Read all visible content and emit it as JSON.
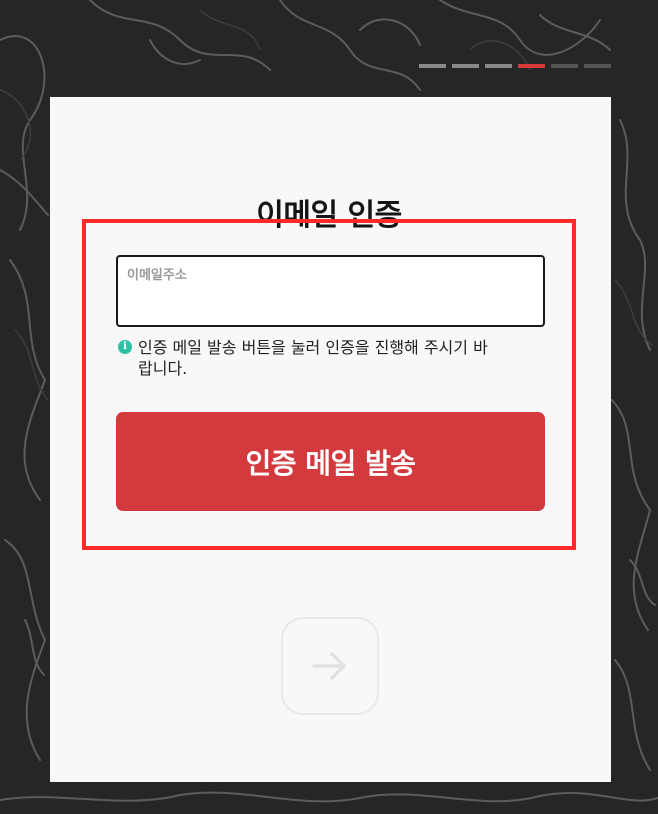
{
  "progress": {
    "total_steps": 6,
    "current_step": 4,
    "colors": {
      "done": "#8a8a8a",
      "current": "#d9383b",
      "upcoming": "#555555"
    }
  },
  "form": {
    "title": "이메일 인증",
    "email_field": {
      "label": "이메일주소",
      "value": "",
      "placeholder": ""
    },
    "help_icon": "info-icon",
    "help_text": "인증 메일 발송 버튼을 눌러 인증을 진행해 주시기 바랍니다.",
    "send_button_label": "인증 메일 발송",
    "next_button_icon": "arrow-right-icon"
  },
  "colors": {
    "accent": "#d23a3d",
    "info": "#2fc1a5",
    "highlight_border": "#ff2a2a",
    "card_bg": "#f8f8f8",
    "page_bg": "#262626"
  }
}
